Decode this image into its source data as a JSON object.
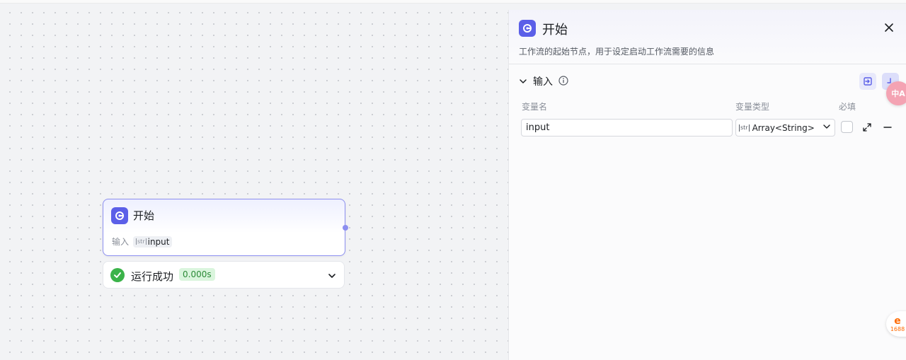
{
  "canvas": {
    "node": {
      "title": "开始",
      "inputs_label": "输入",
      "input_type": "str",
      "input_name": "input"
    },
    "run_result": {
      "status": "运行成功",
      "time": "0.000s"
    }
  },
  "panel": {
    "title": "开始",
    "description": "工作流的起始节点，用于设定启动工作流需要的信息",
    "section_title": "输入",
    "columns": {
      "var_name": "变量名",
      "var_type": "变量类型",
      "required": "必填"
    },
    "rows": [
      {
        "name": "input",
        "type_tag": "str",
        "type": "Array<String>",
        "required": false
      }
    ]
  },
  "floating": {
    "translate_label": "中A",
    "ali_label": "1688"
  },
  "colors": {
    "accent": "#5b5fe8",
    "success": "#3bb34a"
  }
}
